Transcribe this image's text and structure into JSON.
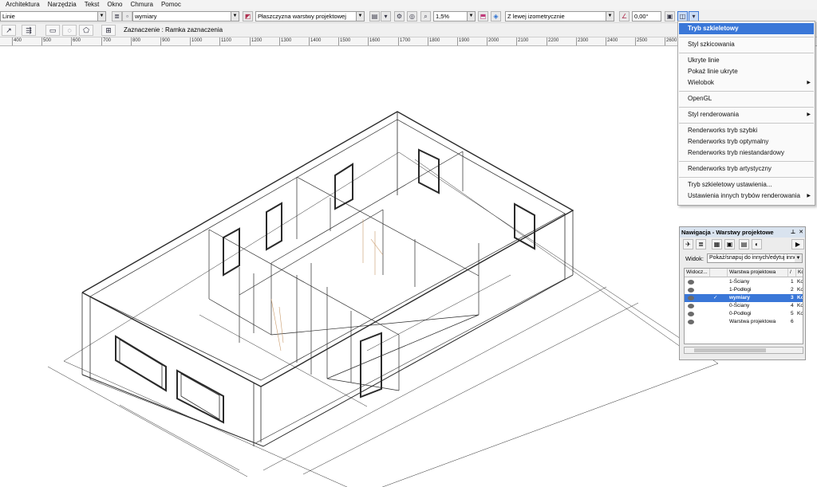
{
  "menubar": [
    "Architektura",
    "Narzędzia",
    "Tekst",
    "Okno",
    "Chmura",
    "Pomoc"
  ],
  "toolbar": {
    "class_value": "Linie",
    "layer_value": "wymiary",
    "plane_value": "Płaszczyzna warstwy projektowej",
    "zoom_value": "1,5%",
    "view_value": "Z lewej izometrycznie",
    "angle_value": "0,00°"
  },
  "toolbar2": {
    "selection_mode": "Zaznaczenie : Ramka zaznaczenia"
  },
  "ruler": [
    "400",
    "500",
    "600",
    "700",
    "800",
    "900",
    "1000",
    "1100",
    "1200",
    "1300",
    "1400",
    "1500",
    "1600",
    "1700",
    "1800",
    "1900",
    "2000",
    "2100",
    "2200",
    "2300",
    "2400",
    "2500",
    "2600"
  ],
  "render_menu": {
    "items": [
      {
        "label": "Tryb szkieletowy",
        "highlighted": true,
        "submenu": false
      },
      {
        "label": "Styl szkicowania",
        "submenu": false
      },
      {
        "label": "Ukryte linie",
        "submenu": false
      },
      {
        "label": "Pokaż linie ukryte",
        "submenu": false
      },
      {
        "label": "Wielobok",
        "submenu": true
      },
      {
        "label": "OpenGL",
        "submenu": false
      },
      {
        "label": "Styl renderowania",
        "submenu": true
      },
      {
        "label": "Renderworks tryb szybki",
        "submenu": false
      },
      {
        "label": "Renderworks tryb optymalny",
        "submenu": false
      },
      {
        "label": "Renderworks tryb niestandardowy",
        "submenu": false
      },
      {
        "label": "Renderworks tryb artystyczny",
        "submenu": false
      },
      {
        "label": "Tryb szkieletowy ustawienia...",
        "submenu": false
      },
      {
        "label": "Ustawienia innych trybów renderowania",
        "submenu": true
      }
    ]
  },
  "nav_palette": {
    "title": "Nawigacja - Warstwy projektowe",
    "view_label": "Widok:",
    "view_value": "Pokaż/snapuj do innych/edytuj inne",
    "col_visibility": "Widocz...",
    "col_layer": "Warstwa projektowa",
    "col_num": "/",
    "col_ko": "Ko",
    "rows": [
      {
        "name": "1-Ściany",
        "num": "1",
        "ko": "Ko",
        "active": false
      },
      {
        "name": "1-Podłogi",
        "num": "2",
        "ko": "Ko",
        "active": false
      },
      {
        "name": "wymiary",
        "num": "3",
        "ko": "Ko",
        "active": true,
        "check": "✓"
      },
      {
        "name": "0-Ściany",
        "num": "4",
        "ko": "Ko",
        "active": false
      },
      {
        "name": "0-Podłogi",
        "num": "5",
        "ko": "Ko",
        "active": false
      },
      {
        "name": "Warstwa projektowa",
        "num": "6",
        "ko": "",
        "active": false
      }
    ]
  },
  "colors": {
    "highlight": "#3a77d8",
    "wire": "#2a2a2a",
    "accent_wire": "#c89a6a"
  }
}
